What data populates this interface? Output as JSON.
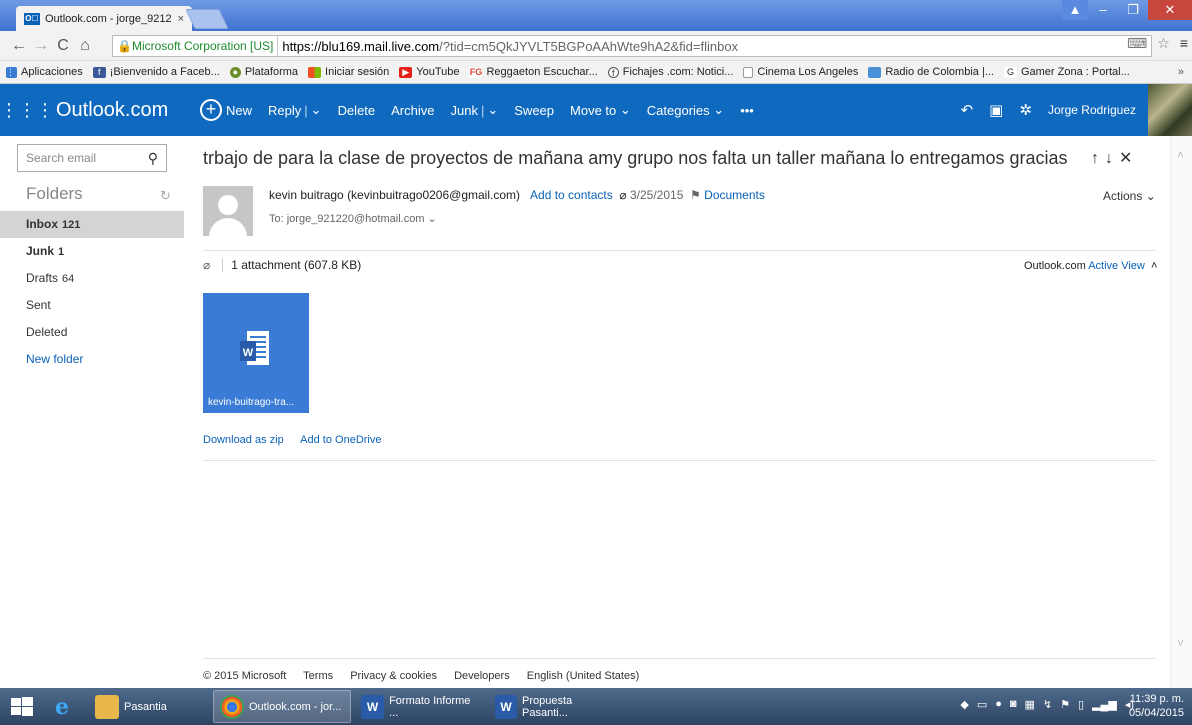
{
  "browser": {
    "tab_title": "Outlook.com - jorge_9212",
    "tab_close": "×",
    "secure_label": "Microsoft Corporation [US]",
    "url_host": "https://blu169.mail.live.com",
    "url_path": "/?tid=cm5QkJYVLT5BGPoAAhWte9hA2&fid=flinbox",
    "bookmarks": [
      {
        "label": "Aplicaciones",
        "icon": "apps-grid-icon"
      },
      {
        "label": "¡Bienvenido a Faceb...",
        "icon": "facebook-icon"
      },
      {
        "label": "Plataforma",
        "icon": "platform-icon"
      },
      {
        "label": "Iniciar sesión",
        "icon": "microsoft-icon"
      },
      {
        "label": "YouTube",
        "icon": "youtube-icon"
      },
      {
        "label": "Reggaeton Escuchar...",
        "icon": "fg-icon"
      },
      {
        "label": "Fichajes .com: Notici...",
        "icon": "fichajes-icon"
      },
      {
        "label": "Cinema Los Angeles",
        "icon": "page-icon"
      },
      {
        "label": "Radio de Colombia |...",
        "icon": "radio-icon"
      },
      {
        "label": "Gamer Zona : Portal...",
        "icon": "gamer-icon"
      }
    ],
    "bookmarks_more": "»"
  },
  "header": {
    "brand": "Outlook.com",
    "commands": {
      "new": "New",
      "reply": "Reply",
      "delete": "Delete",
      "archive": "Archive",
      "junk": "Junk",
      "sweep": "Sweep",
      "move_to": "Move to",
      "categories": "Categories",
      "more": "•••"
    },
    "user_name": "Jorge Rodriguez"
  },
  "left": {
    "search_placeholder": "Search email",
    "folders_title": "Folders",
    "folders": [
      {
        "name": "Inbox",
        "count": "121"
      },
      {
        "name": "Junk",
        "count": "1"
      },
      {
        "name": "Drafts",
        "count": "64"
      },
      {
        "name": "Sent",
        "count": ""
      },
      {
        "name": "Deleted",
        "count": ""
      }
    ],
    "new_folder": "New folder"
  },
  "message": {
    "subject": "trbajo de para la clase de proyectos de mañana amy grupo nos falta un taller mañana lo entregamos gracias",
    "sender_name": "kevin buitrago",
    "sender_email": "(kevinbuitrago0206@gmail.com)",
    "add_to_contacts": "Add to contacts",
    "date": "3/25/2015",
    "category": "Documents",
    "to_line": "To: jorge_921220@hotmail.com",
    "actions": "Actions",
    "attachments_summary": "1 attachment (607.8 KB)",
    "active_view_prefix": "Outlook.com",
    "active_view_link": "Active View",
    "attachment_filename": "kevin-buitrago-tra...",
    "download_zip": "Download as zip",
    "add_onedrive": "Add to OneDrive"
  },
  "footer": {
    "copyright": "© 2015 Microsoft",
    "terms": "Terms",
    "privacy": "Privacy & cookies",
    "developers": "Developers",
    "language": "English (United States)"
  },
  "taskbar": {
    "items": [
      {
        "label": "Pasantia"
      },
      {
        "label": "Outlook.com - jor..."
      },
      {
        "label": "Formato Informe ..."
      },
      {
        "label": "Propuesta Pasanti..."
      }
    ],
    "time": "11:39 p. m.",
    "date": "05/04/2015"
  },
  "colors": {
    "outlook_blue": "#0f6abf",
    "link_blue": "#0a62b8",
    "word_blue": "#3a7bd5"
  }
}
